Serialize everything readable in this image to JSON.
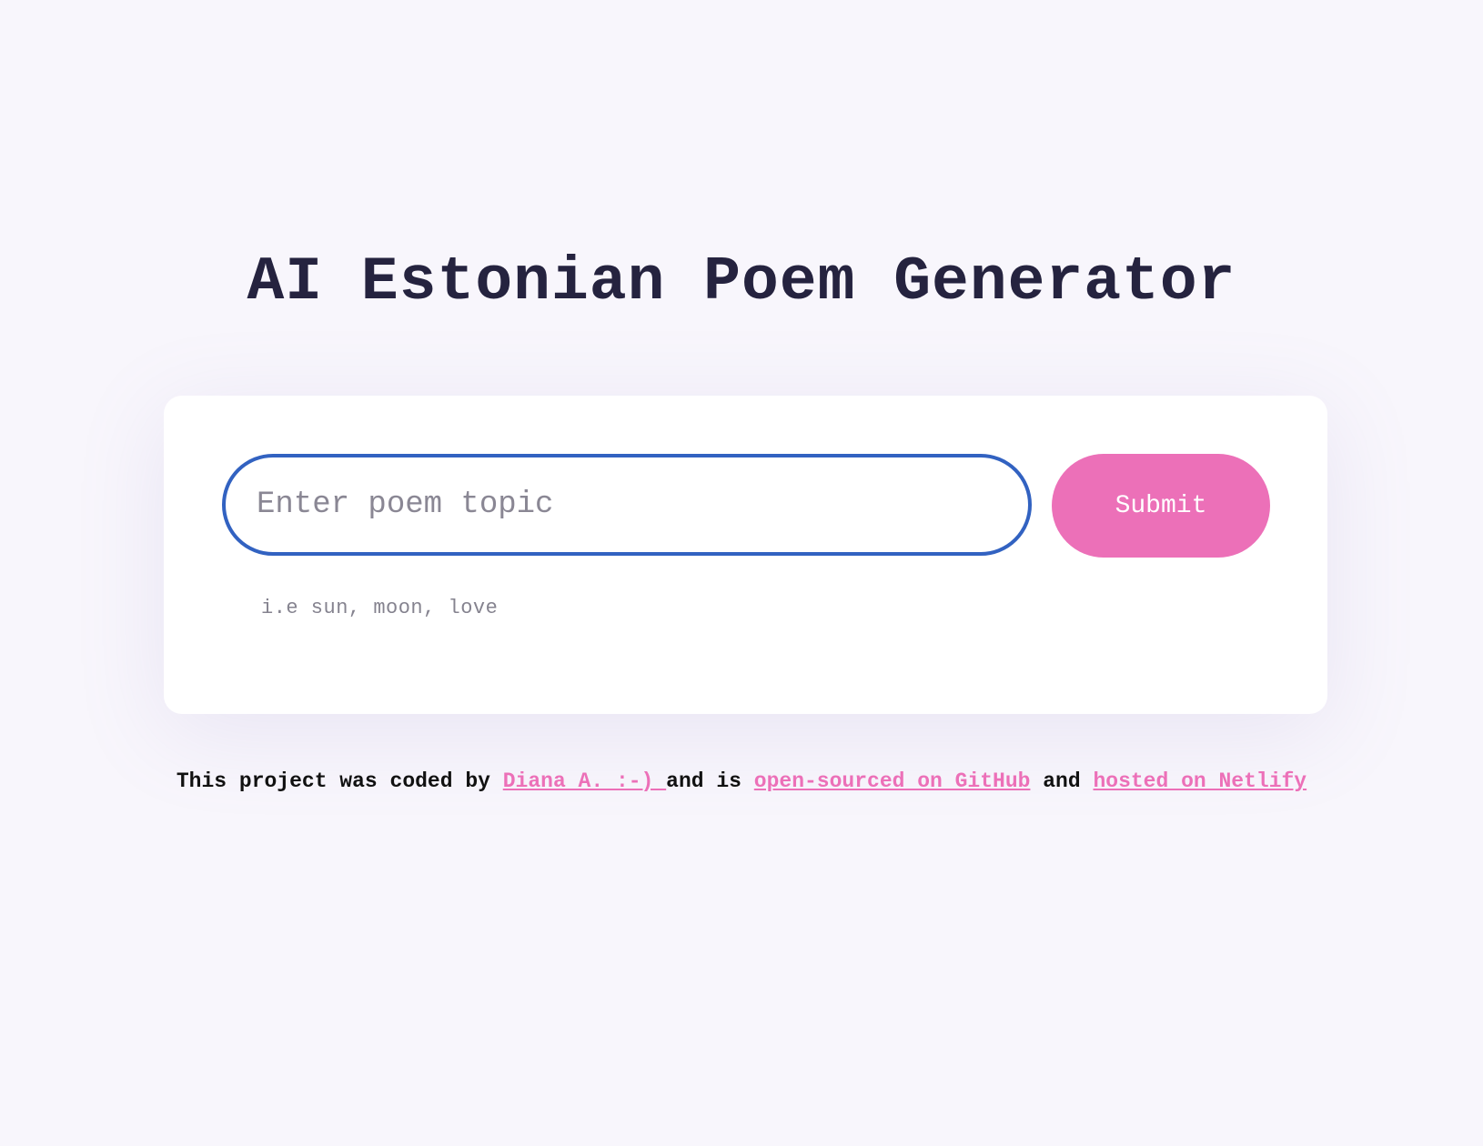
{
  "page": {
    "title": "AI Estonian Poem Generator"
  },
  "form": {
    "input_placeholder": "Enter poem topic",
    "input_value": "",
    "submit_label": "Submit",
    "hint": "i.e sun, moon, love"
  },
  "footer": {
    "prefix": "This project was coded by ",
    "author_link": "Diana A. :-) ",
    "middle": "and is ",
    "github_link": "open-sourced on GitHub",
    "and_text": " and ",
    "netlify_link": "hosted on Netlify"
  },
  "colors": {
    "background": "#f8f6fc",
    "title": "#25233f",
    "input_border": "#3262c1",
    "accent": "#ec70b8"
  }
}
